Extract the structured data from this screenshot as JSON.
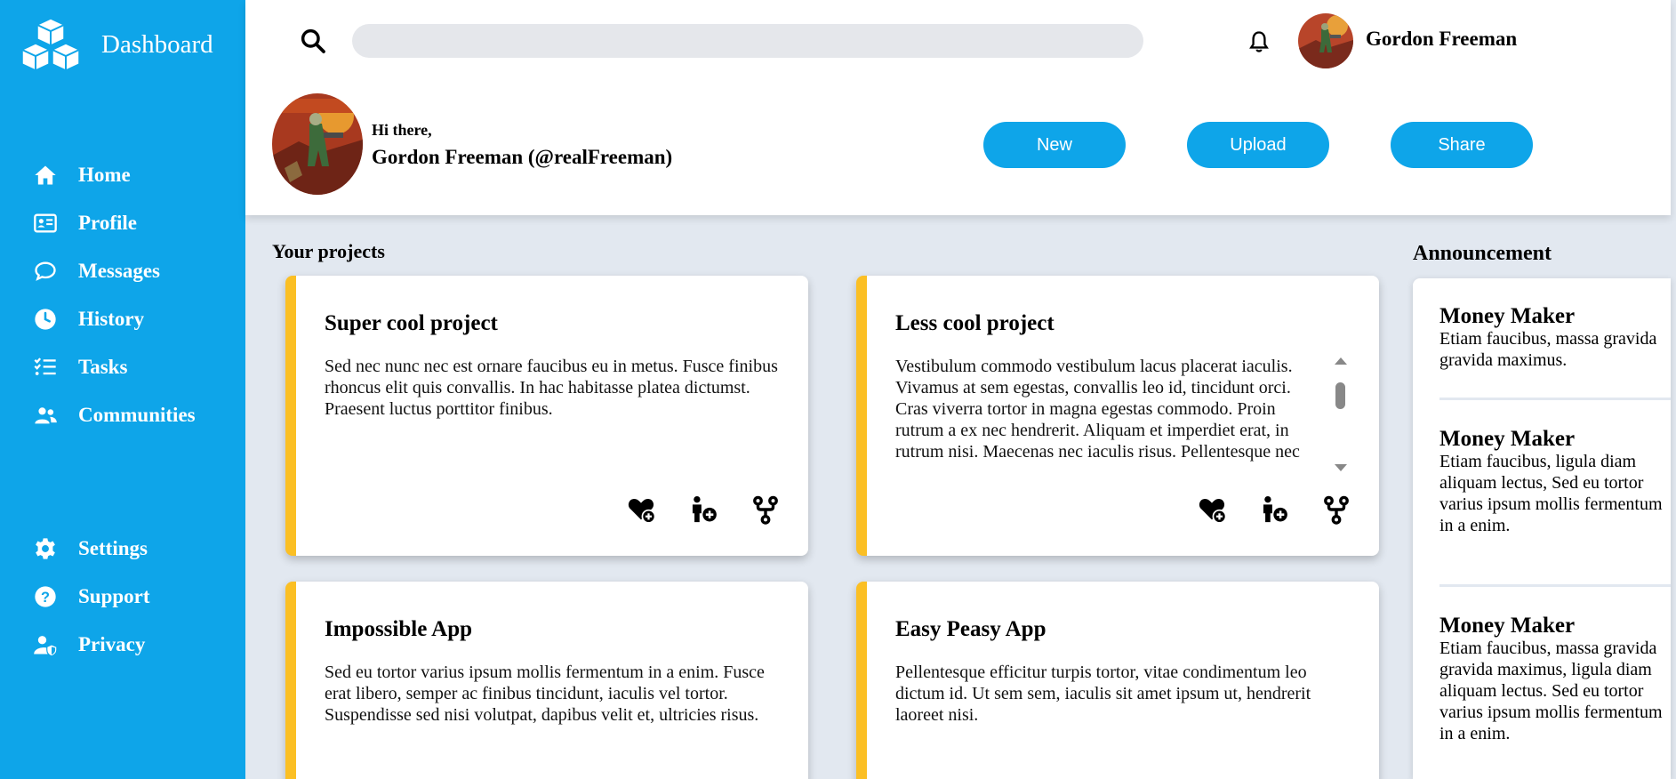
{
  "sidebar": {
    "title": "Dashboard",
    "logo_icon": "cubes-icon",
    "items": [
      {
        "label": "Home",
        "icon": "home-icon"
      },
      {
        "label": "Profile",
        "icon": "id-card-icon"
      },
      {
        "label": "Messages",
        "icon": "chat-bubble-icon"
      },
      {
        "label": "History",
        "icon": "clock-icon"
      },
      {
        "label": "Tasks",
        "icon": "task-list-icon"
      },
      {
        "label": "Communities",
        "icon": "users-icon"
      }
    ],
    "bottom_items": [
      {
        "label": "Settings",
        "icon": "gear-icon"
      },
      {
        "label": "Support",
        "icon": "question-icon"
      },
      {
        "label": "Privacy",
        "icon": "user-shield-icon"
      }
    ],
    "background": "#0ea5e9"
  },
  "header": {
    "search_placeholder": "",
    "user_name": "Gordon Freeman",
    "greeting": "Hi there,",
    "handle": "Gordon Freeman (@realFreeman)",
    "buttons": {
      "new": "New",
      "upload": "Upload",
      "share": "Share"
    }
  },
  "projects": {
    "title": "Your projects",
    "accent": "#fbbf24",
    "items": [
      {
        "title": "Super cool project",
        "description": "Sed nec nunc nec est ornare faucibus eu in metus. Fusce finibus rhoncus elit quis convallis. In hac habitasse platea dictumst. Praesent luctus porttitor finibus."
      },
      {
        "title": "Less cool project",
        "description": "Vestibulum commodo vestibulum lacus placerat iaculis. Vivamus at sem egestas, convallis leo id, tincidunt orci. Cras viverra tortor in magna egestas commodo. Proin rutrum a ex nec hendrerit. Aliquam et imperdiet erat, in rutrum nisi. Maecenas nec iaculis risus. Pellentesque nec"
      },
      {
        "title": "Impossible App",
        "description": "Sed eu tortor varius ipsum mollis fermentum in a enim. Fusce erat libero, semper ac finibus tincidunt, iaculis vel tortor. Suspendisse sed nisi volutpat, dapibus velit et, ultricies risus."
      },
      {
        "title": "Easy Peasy App",
        "description": "Pellentesque efficitur turpis tortor, vitae condimentum leo dictum id. Ut sem sem, iaculis sit amet ipsum ut, hendrerit laoreet nisi."
      }
    ],
    "action_icons": [
      "heart-plus-icon",
      "person-plus-icon",
      "fork-icon"
    ]
  },
  "announcements": {
    "title": "Announcement",
    "items": [
      {
        "title": "Money Maker",
        "body": "Etiam faucibus, massa gravida gravida maximus."
      },
      {
        "title": "Money Maker",
        "body": "Etiam faucibus, ligula diam aliquam lectus, Sed eu tortor varius ipsum mollis fermentum in a enim."
      },
      {
        "title": "Money Maker",
        "body": "Etiam faucibus, massa gravida gravida maximus, ligula diam aliquam lectus. Sed eu tortor varius ipsum mollis fermentum in a enim."
      }
    ]
  }
}
